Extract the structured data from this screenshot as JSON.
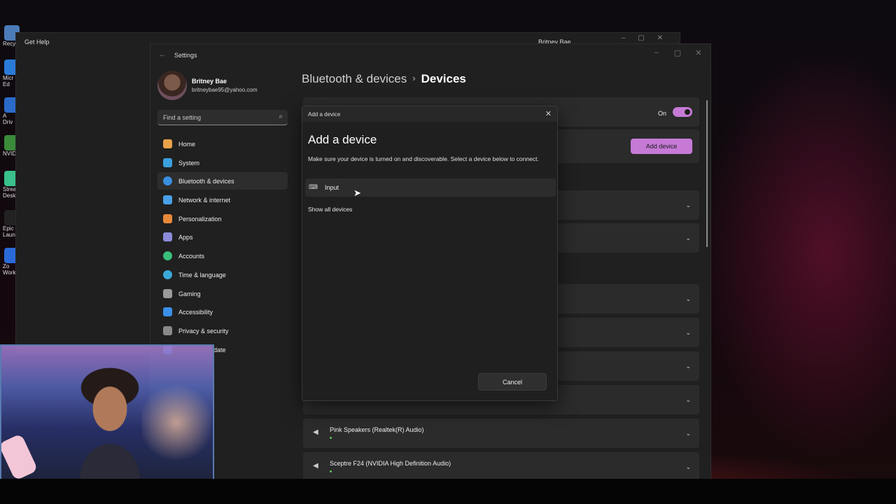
{
  "desktop": {
    "icon_labels": [
      "Recy",
      "Micr",
      "Ed",
      "A",
      "Driv",
      "NVID",
      "Strea",
      "Desk",
      "Epic",
      "Laun",
      "Zo",
      "Work"
    ]
  },
  "get_help": {
    "title": "Get Help",
    "user": "Britney Bae"
  },
  "settings": {
    "app_title": "Settings",
    "profile": {
      "name": "Britney Bae",
      "email": "britneybae95@yahoo.com"
    },
    "search": {
      "placeholder": "Find a setting"
    },
    "nav": [
      {
        "label": "Home",
        "icon": "home-icon",
        "color": "#e8a24a"
      },
      {
        "label": "System",
        "icon": "system-icon",
        "color": "#3aa0e0"
      },
      {
        "label": "Bluetooth & devices",
        "icon": "bluetooth-icon",
        "color": "#3a8fe0",
        "active": true
      },
      {
        "label": "Network & internet",
        "icon": "wifi-icon",
        "color": "#4aa0e8"
      },
      {
        "label": "Personalization",
        "icon": "brush-icon",
        "color": "#e88a3a"
      },
      {
        "label": "Apps",
        "icon": "apps-icon",
        "color": "#8a8ad8"
      },
      {
        "label": "Accounts",
        "icon": "accounts-icon",
        "color": "#3ac07a"
      },
      {
        "label": "Time & language",
        "icon": "globe-icon",
        "color": "#3aa8d8"
      },
      {
        "label": "Gaming",
        "icon": "gaming-icon",
        "color": "#9a9a9a"
      },
      {
        "label": "Accessibility",
        "icon": "accessibility-icon",
        "color": "#3a90e8"
      },
      {
        "label": "Privacy & security",
        "icon": "shield-icon",
        "color": "#8a8a8a"
      },
      {
        "label": "date",
        "icon": "update-icon",
        "color": "#3a90e8"
      }
    ],
    "breadcrumb": {
      "parent": "Bluetooth & devices",
      "separator": "›",
      "current": "Devices"
    },
    "bluetooth_toggle": {
      "label": "On",
      "state": "on",
      "color": "#c67ad6"
    },
    "add_device_button": "Add device",
    "devices": [
      {
        "name": "Pink Speakers (Realtek(R) Audio)"
      },
      {
        "name": "Sceptre F24 (NVIDIA High Definition Audio)"
      }
    ]
  },
  "modal": {
    "bar_title": "Add a device",
    "heading": "Add a device",
    "description": "Make sure your device is turned on and discoverable. Select a device below to connect.",
    "option": "Input",
    "show_all": "Show all devices",
    "cancel": "Cancel"
  }
}
